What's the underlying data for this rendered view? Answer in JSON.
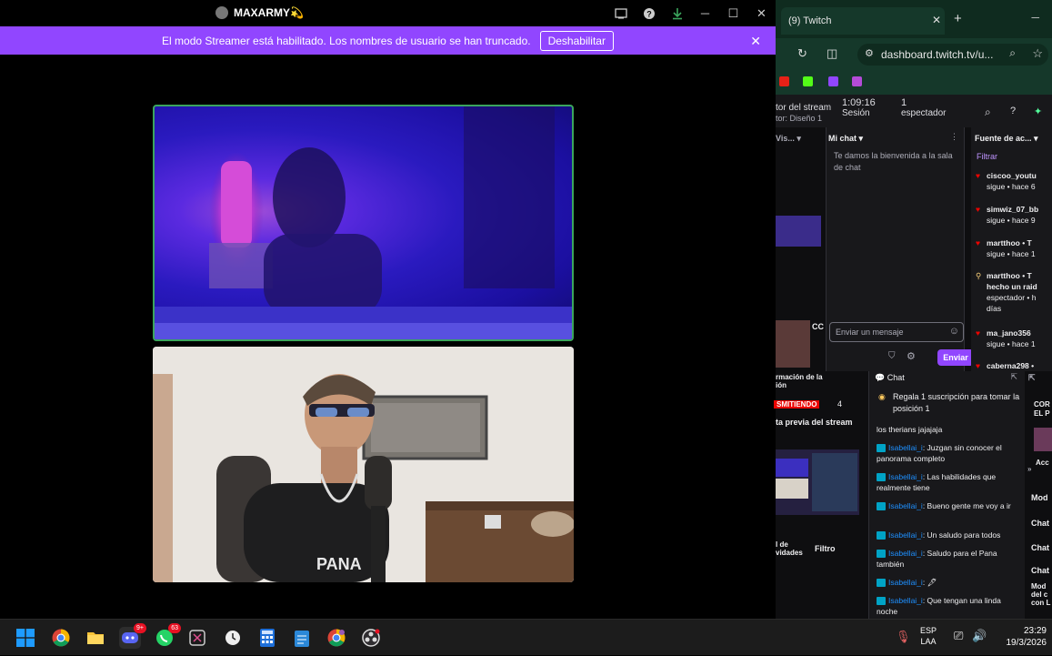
{
  "discord": {
    "window_title": "MAXARMY💫",
    "banner_text": "El modo Streamer está habilitado. Los nombres de usuario se han truncado.",
    "banner_button": "Deshabilitar",
    "cam1_accent": "#3ba55d",
    "cam2_shirt_text": "PANA"
  },
  "browser": {
    "tab_title": "(9) Twitch",
    "url": "dashboard.twitch.tv/u...",
    "stats": {
      "left_label_1": "tor del stream",
      "left_label_2": "tor: Diseño 1",
      "session_time": "1:09:16",
      "session_label": "Sesión",
      "viewers_count": "1",
      "viewers_label": "espectador"
    },
    "left_col_label": "Vis...",
    "mychat": {
      "title": "Mi chat",
      "welcome": "Te damos la bienvenida a la sala de chat",
      "input_placeholder": "Enviar un mensaje",
      "send": "Enviar"
    },
    "activity": {
      "title": "Fuente de ac...",
      "filter": "Filtrar",
      "items": [
        {
          "user": "ciscoo_youtu",
          "line2": "sigue • hace 6"
        },
        {
          "user": "simwiz_07_bb",
          "line2": "sigue • hace 9"
        },
        {
          "user": "martthoo • T",
          "line2": "sigue • hace 1"
        },
        {
          "user": "martthoo • T",
          "line2": "hecho un raid",
          "line3": "espectador • h",
          "line4": "días"
        },
        {
          "user": "ma_jano356",
          "line2": "sigue • hace 1"
        },
        {
          "user": "caberna298 •",
          "line2": ""
        }
      ]
    },
    "lower_left": {
      "info_label_1": "rmación de la",
      "info_label_2": "ión",
      "live_badge": "SMITIENDO",
      "live_count": "4",
      "preview_label": "ta previa del stream",
      "activity_label_1": "l de",
      "activity_label_2": "vidades",
      "filter": "Filtro"
    },
    "chat": {
      "title": "Chat",
      "pinned": "Regala 1 suscripción para tomar la posición 1",
      "messages": [
        {
          "user": "",
          "text": "los therians jajajaja"
        },
        {
          "user": "Isabellai_i",
          "text": "Juzgan sin conocer el panorama completo"
        },
        {
          "user": "Isabellai_i",
          "text": "Las habilidades que realmente tiene"
        },
        {
          "user": "Isabellai_i",
          "text": "Bueno gente me voy a ir"
        },
        {
          "user": "Isabellai_i",
          "text": "Un saludo para todos"
        },
        {
          "user": "Isabellai_i",
          "text": "Saludo para el Pana también"
        },
        {
          "user": "Isabellai_i",
          "text": "🖋"
        },
        {
          "user": "Isabellai_i",
          "text": "Que tengan una linda noche"
        }
      ]
    },
    "right_strip": {
      "label_1": "COR EL P",
      "label_2": "Acc",
      "label_3": "Mod",
      "label_4": "Chat",
      "label_5": "Chat",
      "label_6": "Chat",
      "label_7": "Mod del c con L"
    }
  },
  "taskbar": {
    "discord_badge": "9+",
    "whatsapp_badge": "63",
    "lang_1": "ESP",
    "lang_2": "LAA",
    "time": "23:29",
    "date": "19/3/2026"
  }
}
